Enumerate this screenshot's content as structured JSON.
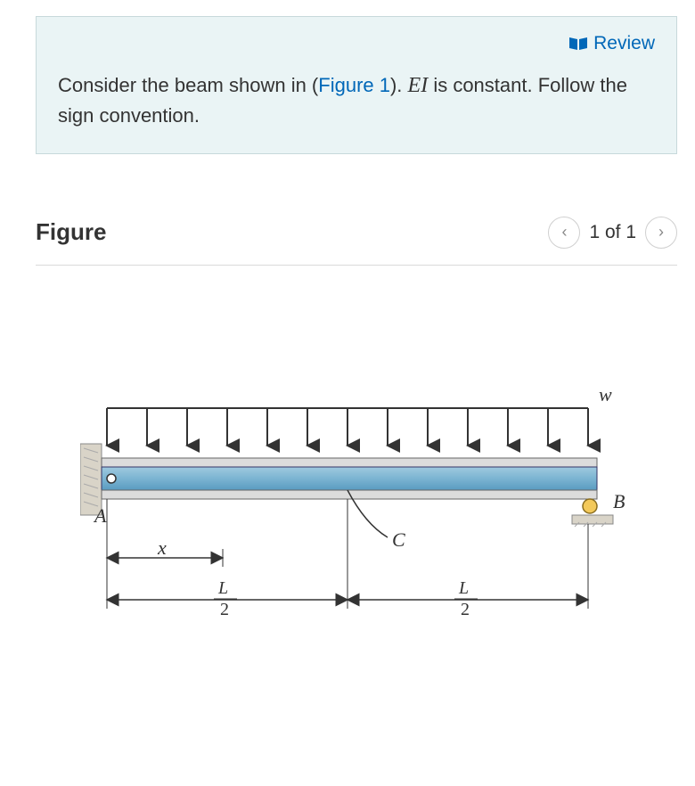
{
  "review": {
    "label": "Review"
  },
  "prompt": {
    "part1": "Consider the beam shown in (",
    "figlink": "Figure 1",
    "part2": "). ",
    "ei": "EI",
    "part3": " is constant. Follow the sign convention."
  },
  "figure": {
    "title": "Figure",
    "nav": {
      "text": "1 of 1"
    }
  },
  "diagram": {
    "labels": {
      "w": "w",
      "A": "A",
      "B": "B",
      "C": "C",
      "x": "x",
      "L": "L",
      "two": "2"
    }
  }
}
